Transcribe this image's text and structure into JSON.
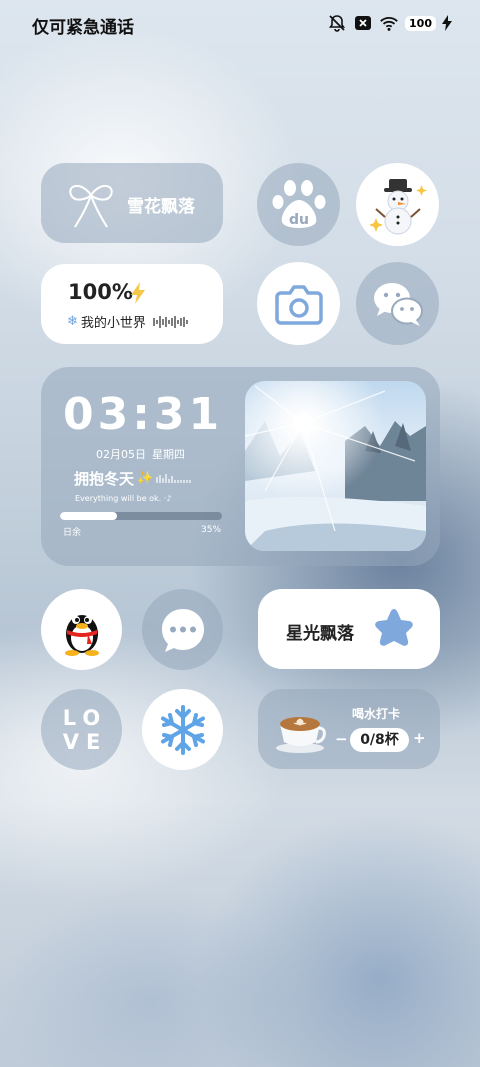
{
  "status_bar": {
    "left_text": "仅可紧急通话",
    "battery": "100",
    "icons": [
      "silent-bell-icon",
      "no-sim-icon",
      "wifi-icon",
      "battery-icon",
      "charging-bolt-icon"
    ]
  },
  "widgets": {
    "snow_widget": {
      "label": "雪花飘落",
      "icon": "ribbon-bow-icon"
    },
    "battery_widget": {
      "percent": "100%",
      "caption": "我的小世界",
      "icons": [
        "bolt-icon",
        "snowflake-icon",
        "soundwave-icon"
      ]
    },
    "clock_widget": {
      "time": "03:31",
      "date": "02月05日",
      "weekday": "星期四",
      "headline": "拥抱冬天",
      "subtitle": "Everything will be ok.",
      "remaining_label": "日余",
      "progress_text": "35%",
      "progress_value": 0.35
    },
    "star_widget": {
      "label": "星光飘落",
      "icon": "blue-star-icon"
    },
    "water_widget": {
      "title": "喝水打卡",
      "minus": "−",
      "count": "0/8杯",
      "plus": "+",
      "icon": "latte-cup-icon"
    }
  },
  "apps": [
    {
      "name": "baidu",
      "icon": "baidu-paw-icon"
    },
    {
      "name": "snowman",
      "icon": "snowman-icon"
    },
    {
      "name": "camera",
      "icon": "camera-icon"
    },
    {
      "name": "wechat",
      "icon": "wechat-icon"
    },
    {
      "name": "qq",
      "icon": "qq-penguin-icon"
    },
    {
      "name": "messages",
      "icon": "message-bubble-icon"
    },
    {
      "name": "love",
      "icon": "love-text-icon",
      "text_top": "LO",
      "text_bottom": "VE"
    },
    {
      "name": "snowflake",
      "icon": "snowflake-icon"
    }
  ],
  "colors": {
    "frost_tile": "#96a8bc",
    "white_tile": "#ffffff",
    "accent_blue": "#7fa8dd"
  }
}
